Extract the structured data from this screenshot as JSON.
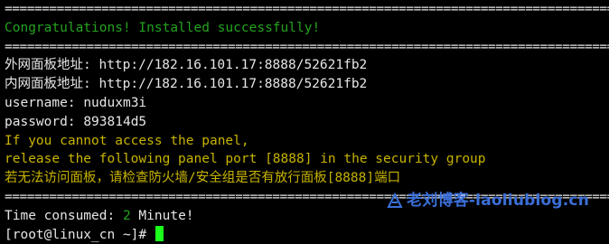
{
  "terminal": {
    "separator": "==================================================================================",
    "lines": {
      "congrats": "Congratulations! Installed successfully!",
      "external_label": "外网面板地址: ",
      "external_url": "http://182.16.101.17:8888/52621fb2",
      "internal_label": "内网面板地址: ",
      "internal_url": "http://182.16.101.17:8888/52621fb2",
      "username_label": "username: ",
      "username_value": "nuduxm3i",
      "password_label": "password: ",
      "password_value": "893814d5",
      "warn1": "If you cannot access the panel,",
      "warn2": "release the following panel port [8888] in the security group",
      "warn3": "若无法访问面板，请检查防火墙/安全组是否有放行面板[8888]端口",
      "time_prefix": "Time consumed: ",
      "time_value": "2",
      "time_suffix": " Minute!",
      "prompt": "[root@linux_cn ~]# "
    },
    "colors": {
      "success": "#24a31f",
      "warning": "#c8b400",
      "text": "#e6e6e6",
      "cursor": "#1cff1c",
      "watermark": "#3b6fd8"
    }
  },
  "watermark": {
    "text": "老刘博客-laoliublog.cn",
    "icon": "watermark-logo-icon"
  }
}
